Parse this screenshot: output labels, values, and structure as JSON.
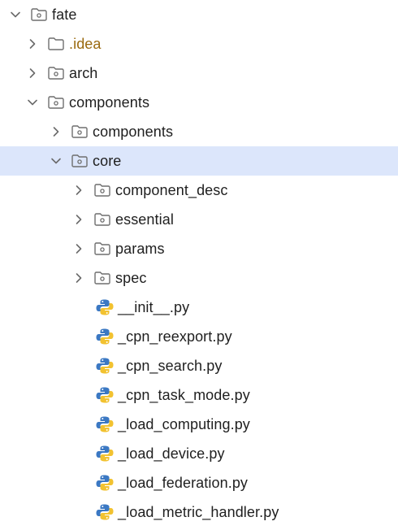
{
  "colors": {
    "selected_row": "#dce6fb",
    "idea_text": "#9a6a10",
    "python_blue": "#3b78c3",
    "python_yellow": "#f2c230"
  },
  "tree": {
    "items": [
      {
        "label": "fate",
        "type": "folder",
        "expanded": true,
        "icon": "folder-icon",
        "chevron": "chevron-down-icon"
      },
      {
        "label": ".idea",
        "type": "folder",
        "expanded": false,
        "icon": "folder-icon",
        "chevron": "chevron-right-icon"
      },
      {
        "label": "arch",
        "type": "folder",
        "expanded": false,
        "icon": "folder-icon",
        "chevron": "chevron-right-icon"
      },
      {
        "label": "components",
        "type": "folder",
        "expanded": true,
        "icon": "folder-icon",
        "chevron": "chevron-down-icon"
      },
      {
        "label": "components",
        "type": "folder",
        "expanded": false,
        "icon": "folder-icon",
        "chevron": "chevron-right-icon"
      },
      {
        "label": "core",
        "type": "folder",
        "expanded": true,
        "selected": true,
        "icon": "folder-icon",
        "chevron": "chevron-down-icon"
      },
      {
        "label": "component_desc",
        "type": "folder",
        "expanded": false,
        "icon": "folder-icon",
        "chevron": "chevron-right-icon"
      },
      {
        "label": "essential",
        "type": "folder",
        "expanded": false,
        "icon": "folder-icon",
        "chevron": "chevron-right-icon"
      },
      {
        "label": "params",
        "type": "folder",
        "expanded": false,
        "icon": "folder-icon",
        "chevron": "chevron-right-icon"
      },
      {
        "label": "spec",
        "type": "folder",
        "expanded": false,
        "icon": "folder-icon",
        "chevron": "chevron-right-icon"
      },
      {
        "label": "__init__.py",
        "type": "file",
        "icon": "python-file-icon"
      },
      {
        "label": "_cpn_reexport.py",
        "type": "file",
        "icon": "python-file-icon"
      },
      {
        "label": "_cpn_search.py",
        "type": "file",
        "icon": "python-file-icon"
      },
      {
        "label": "_cpn_task_mode.py",
        "type": "file",
        "icon": "python-file-icon"
      },
      {
        "label": "_load_computing.py",
        "type": "file",
        "icon": "python-file-icon"
      },
      {
        "label": "_load_device.py",
        "type": "file",
        "icon": "python-file-icon"
      },
      {
        "label": "_load_federation.py",
        "type": "file",
        "icon": "python-file-icon"
      },
      {
        "label": "_load_metric_handler.py",
        "type": "file",
        "icon": "python-file-icon"
      }
    ]
  }
}
